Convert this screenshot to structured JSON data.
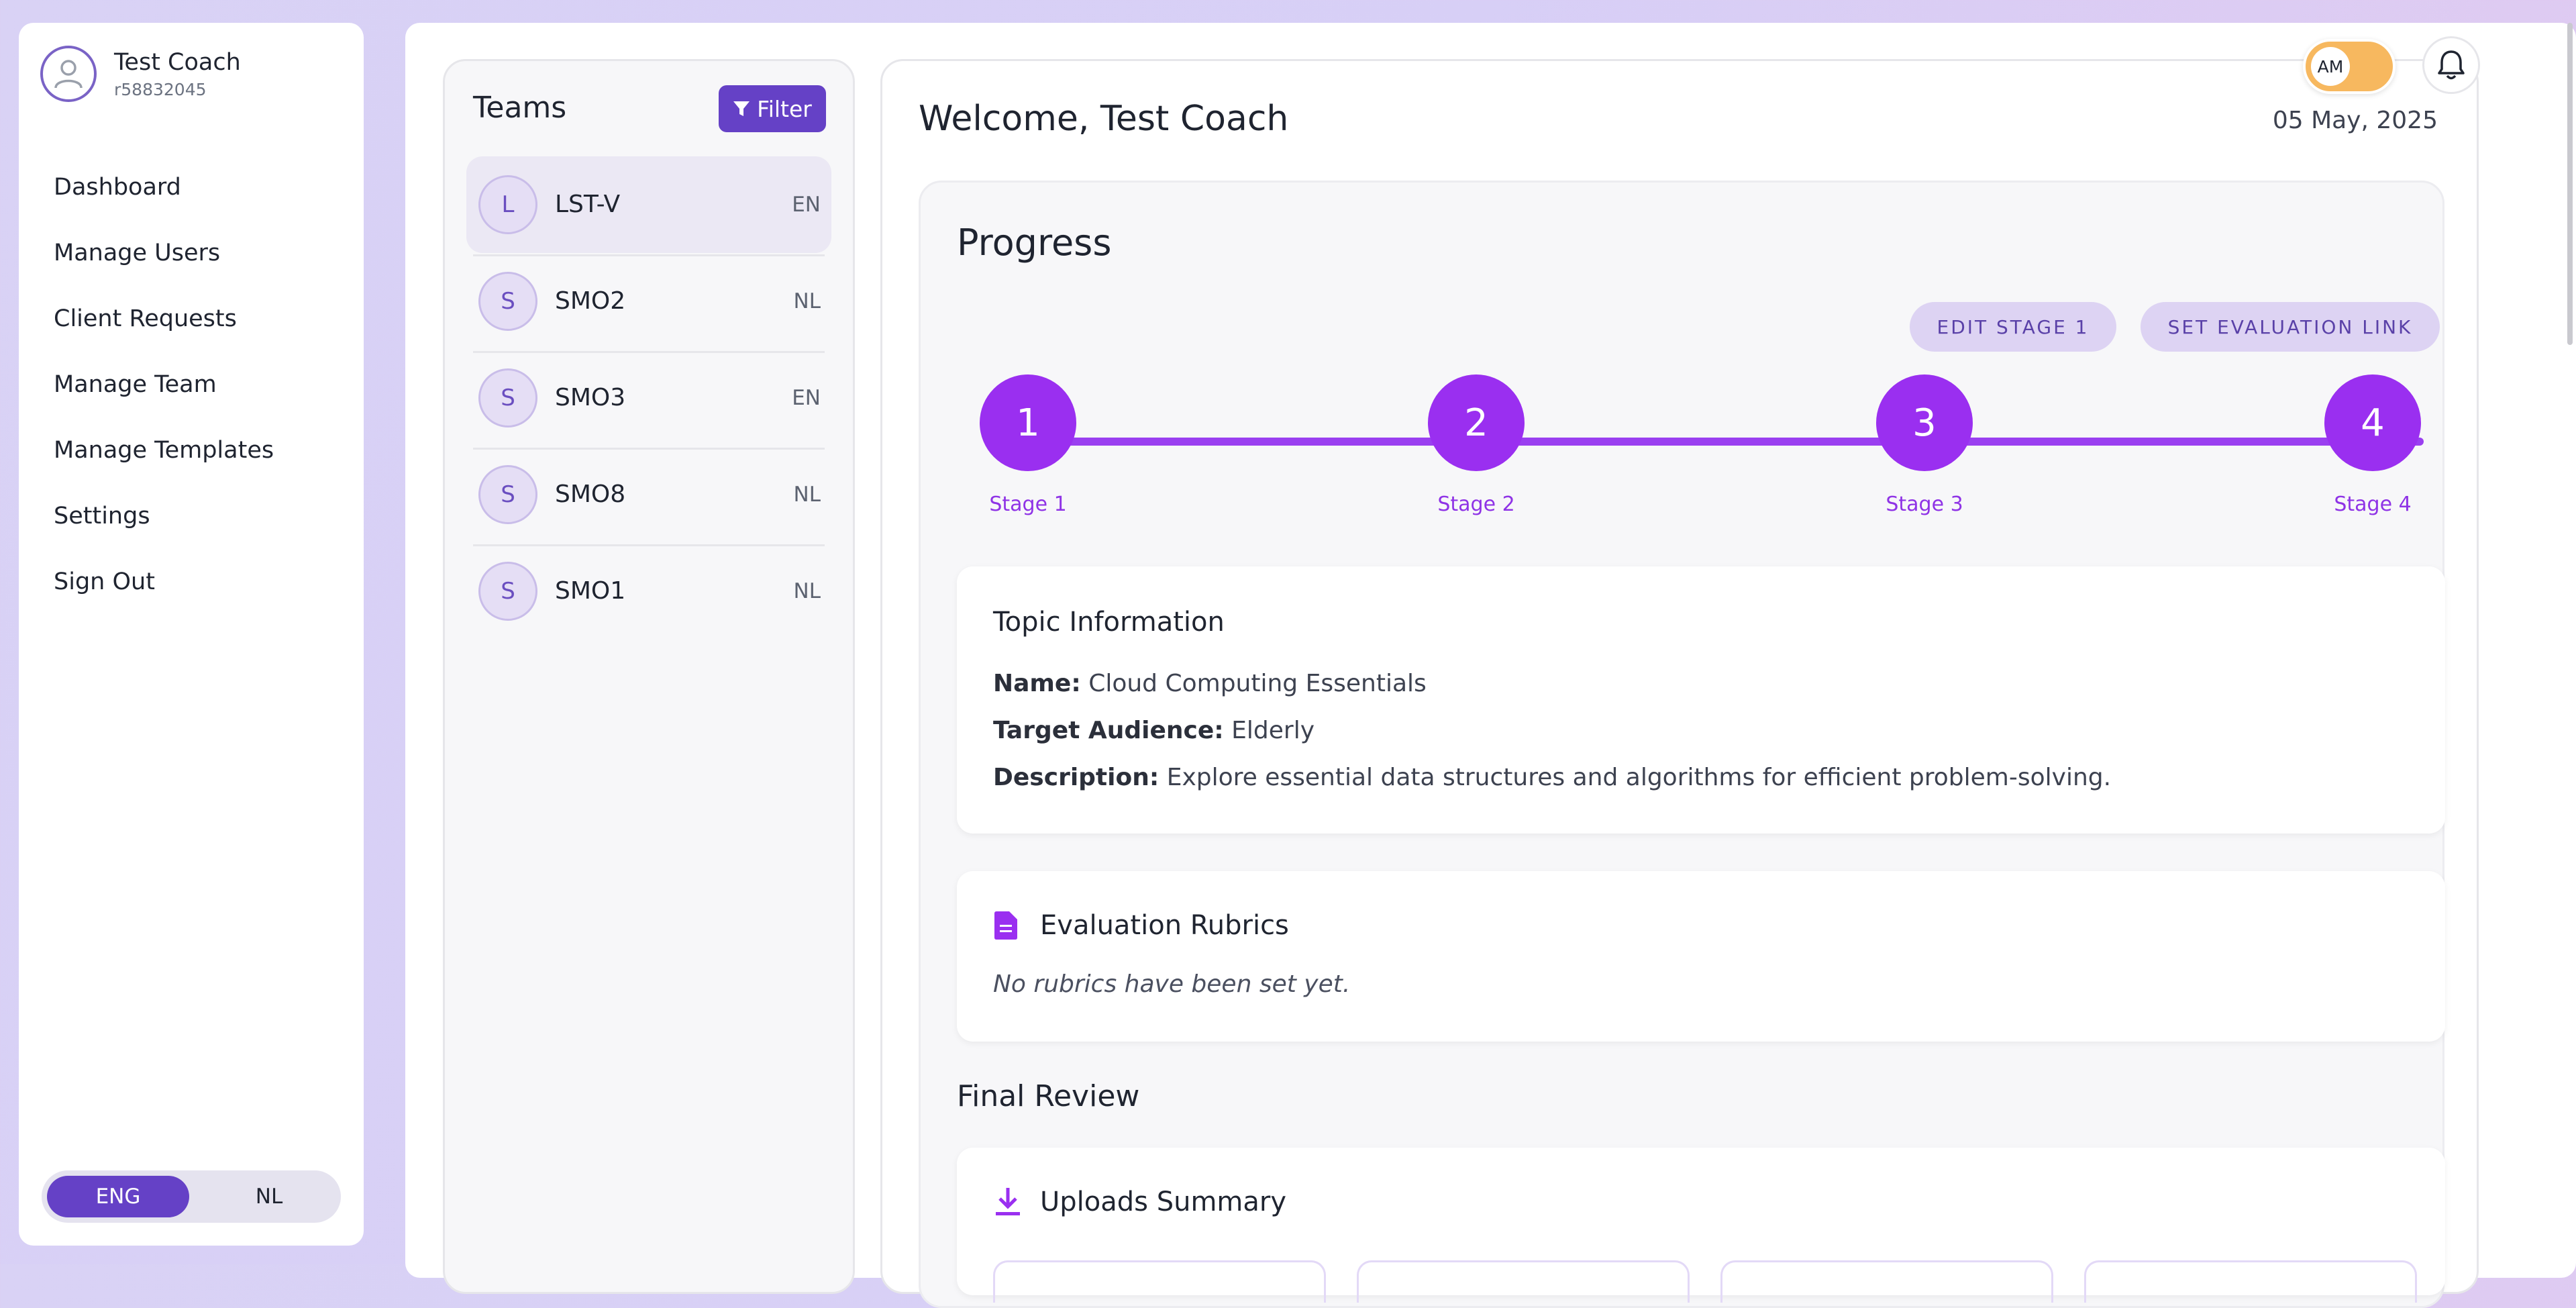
{
  "user": {
    "name": "Test Coach",
    "id": "r58832045"
  },
  "nav": [
    "Dashboard",
    "Manage Users",
    "Client Requests",
    "Manage Team",
    "Manage Templates",
    "Settings",
    "Sign Out"
  ],
  "language": {
    "eng": "ENG",
    "nl": "NL",
    "selected": "ENG"
  },
  "teams": {
    "title": "Teams",
    "filter_label": "Filter",
    "list": [
      {
        "initial": "L",
        "name": "LST-V",
        "lang": "EN",
        "selected": true
      },
      {
        "initial": "S",
        "name": "SMO2",
        "lang": "NL"
      },
      {
        "initial": "S",
        "name": "SMO3",
        "lang": "EN"
      },
      {
        "initial": "S",
        "name": "SMO8",
        "lang": "NL"
      },
      {
        "initial": "S",
        "name": "SMO1",
        "lang": "NL"
      }
    ]
  },
  "header": {
    "welcome": "Welcome, Test Coach",
    "date": "05 May, 2025",
    "toggle_label": "AM"
  },
  "progress": {
    "title": "Progress",
    "edit_button": "EDIT STAGE 1",
    "eval_button": "SET EVALUATION LINK",
    "stages": [
      {
        "num": "1",
        "label": "Stage 1"
      },
      {
        "num": "2",
        "label": "Stage 2"
      },
      {
        "num": "3",
        "label": "Stage 3"
      },
      {
        "num": "4",
        "label": "Stage 4"
      }
    ]
  },
  "topic": {
    "title": "Topic Information",
    "name_label": "Name:",
    "name": "Cloud Computing Essentials",
    "audience_label": "Target Audience:",
    "audience": "Elderly",
    "desc_label": "Description:",
    "desc": "Explore essential data structures and algorithms for efficient problem-solving."
  },
  "rubrics": {
    "title": "Evaluation Rubrics",
    "empty": "No rubrics have been set yet."
  },
  "final_review": {
    "title": "Final Review",
    "uploads_title": "Uploads Summary"
  },
  "colors": {
    "primary": "#6541c6",
    "stage": "#9a2ff0",
    "toggle": "#f7b85f"
  }
}
